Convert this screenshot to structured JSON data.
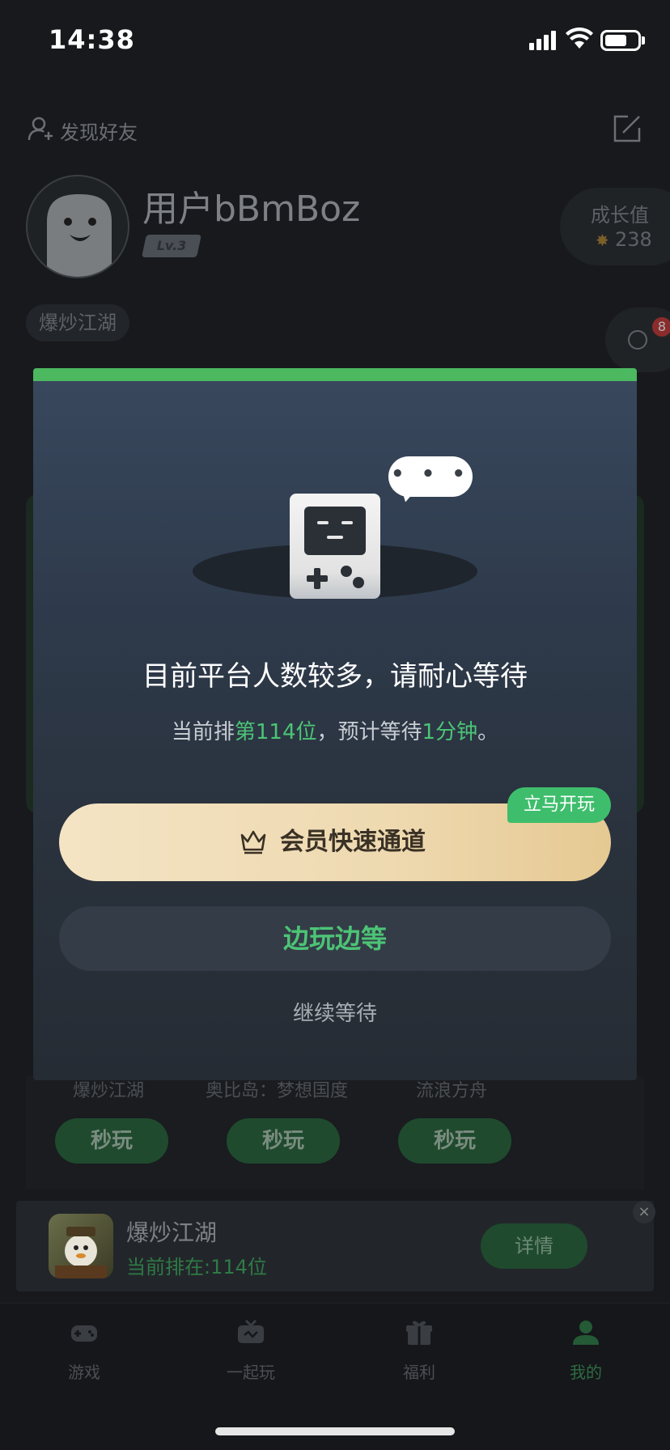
{
  "status_bar": {
    "time": "14:38"
  },
  "header": {
    "find_friends": "发现好友"
  },
  "profile": {
    "username": "用户bBmBoz",
    "level": "Lv.3",
    "growth_label": "成长值",
    "growth_value": "238",
    "game_chip": "爆炒江湖",
    "message_count": "8"
  },
  "background_games": {
    "names": [
      "爆炒江湖",
      "奥比岛：梦想国度",
      "流浪方舟"
    ],
    "play_label": "秒玩"
  },
  "queue_bar": {
    "title": "爆炒江湖",
    "status": "当前排在:114位",
    "detail_button": "详情",
    "close": "×"
  },
  "tabs": [
    {
      "label": "游戏"
    },
    {
      "label": "一起玩"
    },
    {
      "label": "福利"
    },
    {
      "label": "我的"
    }
  ],
  "modal": {
    "bubble": "• • •",
    "title": "目前平台人数较多，请耐心等待",
    "sub_prefix": "当前排",
    "sub_position": "第114位",
    "sub_middle": "，预计等待",
    "sub_time": "1分钟",
    "sub_suffix": "。",
    "vip_button": "会员快速通道",
    "vip_tag": "立马开玩",
    "play_while_waiting": "边玩边等",
    "continue_waiting": "继续等待"
  },
  "colors": {
    "accent_green": "#4cc476",
    "modal_top": "#4cb860",
    "vip_gold": "#eed9b0"
  }
}
